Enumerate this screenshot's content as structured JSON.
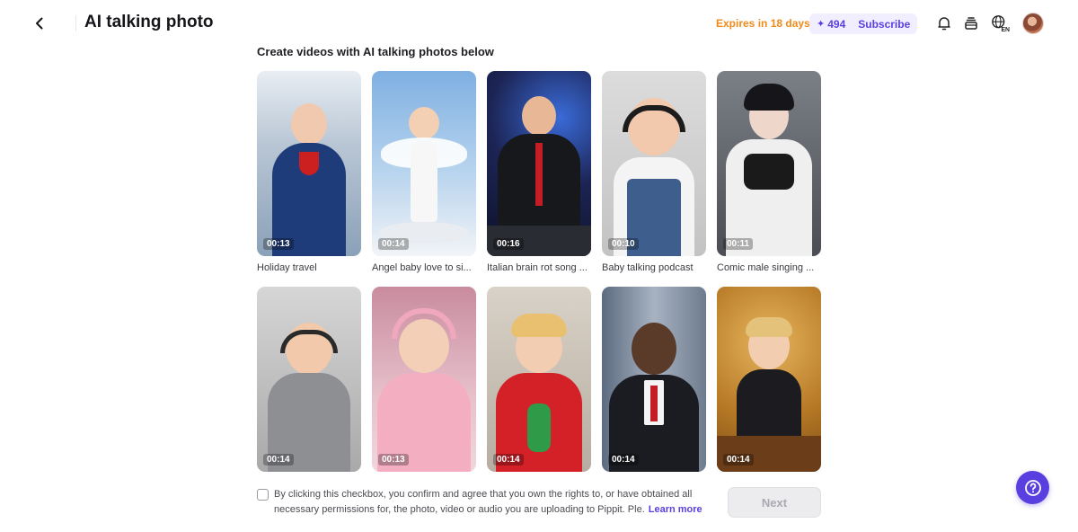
{
  "header": {
    "title": "AI talking photo",
    "expires": "Expires in 18 days",
    "credits": "494",
    "subscribe": "Subscribe",
    "language": "EN"
  },
  "section": {
    "heading": "Create videos with AI talking photos below"
  },
  "cards": [
    {
      "label": "Holiday travel",
      "duration": "00:13",
      "bg": "#9fb3c9"
    },
    {
      "label": "Angel baby love to si...",
      "duration": "00:14",
      "bg": "#8fb7e0"
    },
    {
      "label": "Italian brain rot song ...",
      "duration": "00:16",
      "bg": "#27306a"
    },
    {
      "label": "Baby talking podcast",
      "duration": "00:10",
      "bg": "#cfcfcf"
    },
    {
      "label": "Comic male singing ...",
      "duration": "00:11",
      "bg": "#5d6166"
    },
    {
      "label": "",
      "duration": "00:14",
      "bg": "#bdbdbd"
    },
    {
      "label": "",
      "duration": "00:13",
      "bg": "#e4b8c4"
    },
    {
      "label": "",
      "duration": "00:14",
      "bg": "#c9c0b4"
    },
    {
      "label": "",
      "duration": "00:14",
      "bg": "#8a97a8"
    },
    {
      "label": "",
      "duration": "00:14",
      "bg": "#c98a34"
    }
  ],
  "consent": {
    "text": "By clicking this checkbox, you confirm and agree that you own the rights to, or have obtained all necessary permissions for, the photo, video or audio you are uploading to Pippit. Ple.",
    "learn_more": "Learn more"
  },
  "actions": {
    "next": "Next"
  },
  "colors": {
    "accent": "#5a3fe0",
    "expires": "#f08a1c"
  }
}
